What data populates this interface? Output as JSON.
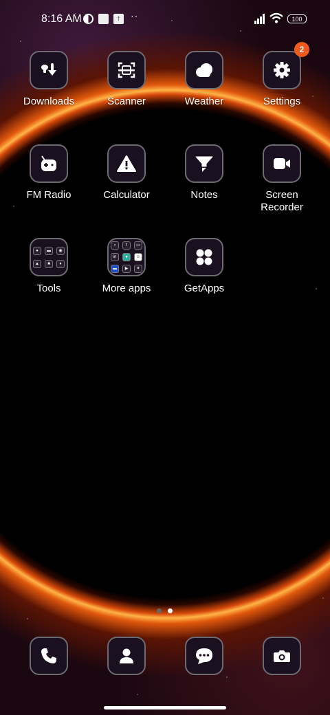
{
  "status_bar": {
    "time": "8:16 AM",
    "battery": "100",
    "icons": [
      "data-saver-icon",
      "square-notification-icon",
      "upload-notification-icon",
      "more-dots-icon",
      "signal-icon",
      "wifi-icon",
      "battery-icon"
    ],
    "dots": "··"
  },
  "apps": [
    {
      "label": "Downloads",
      "icon": "downloads-icon"
    },
    {
      "label": "Scanner",
      "icon": "scanner-icon"
    },
    {
      "label": "Weather",
      "icon": "weather-icon"
    },
    {
      "label": "Settings",
      "icon": "gear-icon",
      "badge": "2"
    },
    {
      "label": "FM Radio",
      "icon": "radio-icon"
    },
    {
      "label": "Calculator",
      "icon": "calculator-icon"
    },
    {
      "label": "Notes",
      "icon": "notes-icon"
    },
    {
      "label": "Screen Recorder",
      "icon": "video-camera-icon"
    },
    {
      "label": "Tools",
      "icon": "folder-icon"
    },
    {
      "label": "More apps",
      "icon": "folder-icon"
    },
    {
      "label": "GetApps",
      "icon": "getapps-icon"
    }
  ],
  "dock": [
    {
      "icon": "phone-icon"
    },
    {
      "icon": "contacts-icon"
    },
    {
      "icon": "messages-icon"
    },
    {
      "icon": "camera-icon"
    }
  ],
  "page_indicator": {
    "pages": 2,
    "current": 2
  },
  "colors": {
    "badge": "#f05a1e",
    "tile_border": "#6e6a72",
    "tile_bg": "#1b1020"
  }
}
